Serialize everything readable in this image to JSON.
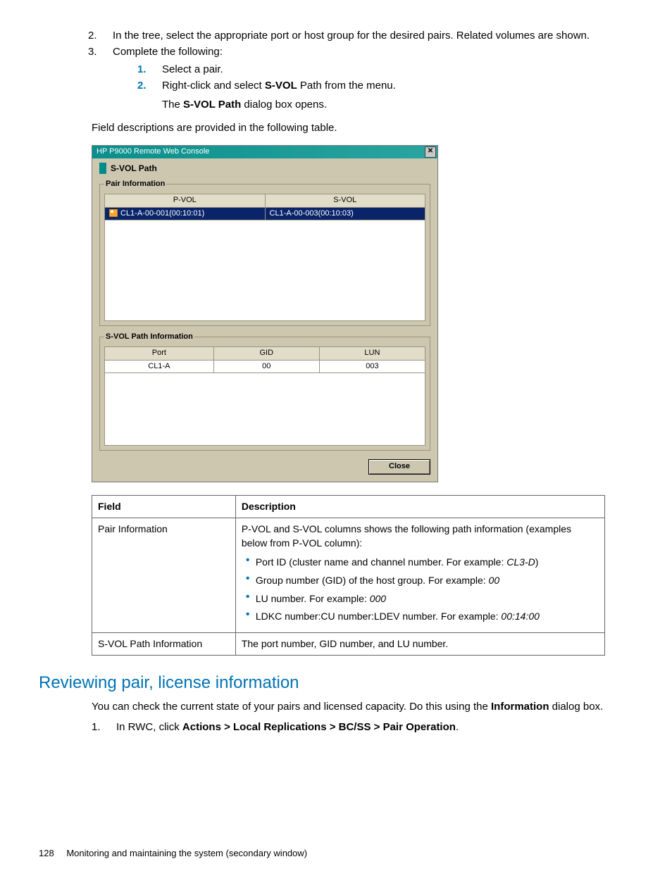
{
  "steps": {
    "s2_num": "2.",
    "s2_text": "In the tree, select the appropriate port or host group for the desired pairs. Related volumes are shown.",
    "s3_num": "3.",
    "s3_text": "Complete the following:",
    "s3a_num": "1.",
    "s3a_text": "Select a pair.",
    "s3b_num": "2.",
    "s3b_text_pre": "Right-click and select ",
    "s3b_bold": "S-VOL",
    "s3b_text_post": " Path from the menu.",
    "s3b_line2_pre": "The ",
    "s3b_line2_bold": "S-VOL Path",
    "s3b_line2_post": " dialog box opens."
  },
  "field_desc_intro": "Field descriptions are provided in the following table.",
  "dialog": {
    "app_title": "HP P9000 Remote Web Console",
    "close_glyph": "✕",
    "title": "S-VOL Path",
    "pair_legend": "Pair Information",
    "pvol_hdr": "P-VOL",
    "svol_hdr": "S-VOL",
    "pvol_val": "CL1-A-00-001(00:10:01)",
    "svol_val": "CL1-A-00-003(00:10:03)",
    "svolpath_legend": "S-VOL Path Information",
    "port_hdr": "Port",
    "gid_hdr": "GID",
    "lun_hdr": "LUN",
    "port_val": "CL1-A",
    "gid_val": "00",
    "lun_val": "003",
    "close_btn": "Close"
  },
  "table": {
    "h_field": "Field",
    "h_desc": "Description",
    "r1_field": "Pair Information",
    "r1_intro": "P-VOL and S-VOL columns shows the following path information (examples below from P-VOL column):",
    "r1_b1_pre": "Port ID (cluster name and channel number. For example: ",
    "r1_b1_em": "CL3-D",
    "r1_b1_post": ")",
    "r1_b2_pre": "Group number (GID) of the host group. For example: ",
    "r1_b2_em": "00",
    "r1_b3_pre": "LU number. For example: ",
    "r1_b3_em": "000",
    "r1_b4_pre": "LDKC number:CU number:LDEV number. For example: ",
    "r1_b4_em": "00:14:00",
    "r2_field": "S-VOL Path Information",
    "r2_desc": "The port number, GID number, and LU number."
  },
  "section": {
    "heading": "Reviewing pair, license information",
    "p1_pre": "You can check the current state of your pairs and licensed capacity. Do this using the ",
    "p1_bold": "Information",
    "p1_post": " dialog box.",
    "step1_num": "1.",
    "step1_pre": "In RWC, click ",
    "step1_bold": "Actions > Local Replications > BC/SS > Pair Operation",
    "step1_post": "."
  },
  "footer": {
    "page": "128",
    "chapter": "Monitoring and maintaining the system (secondary window)"
  }
}
